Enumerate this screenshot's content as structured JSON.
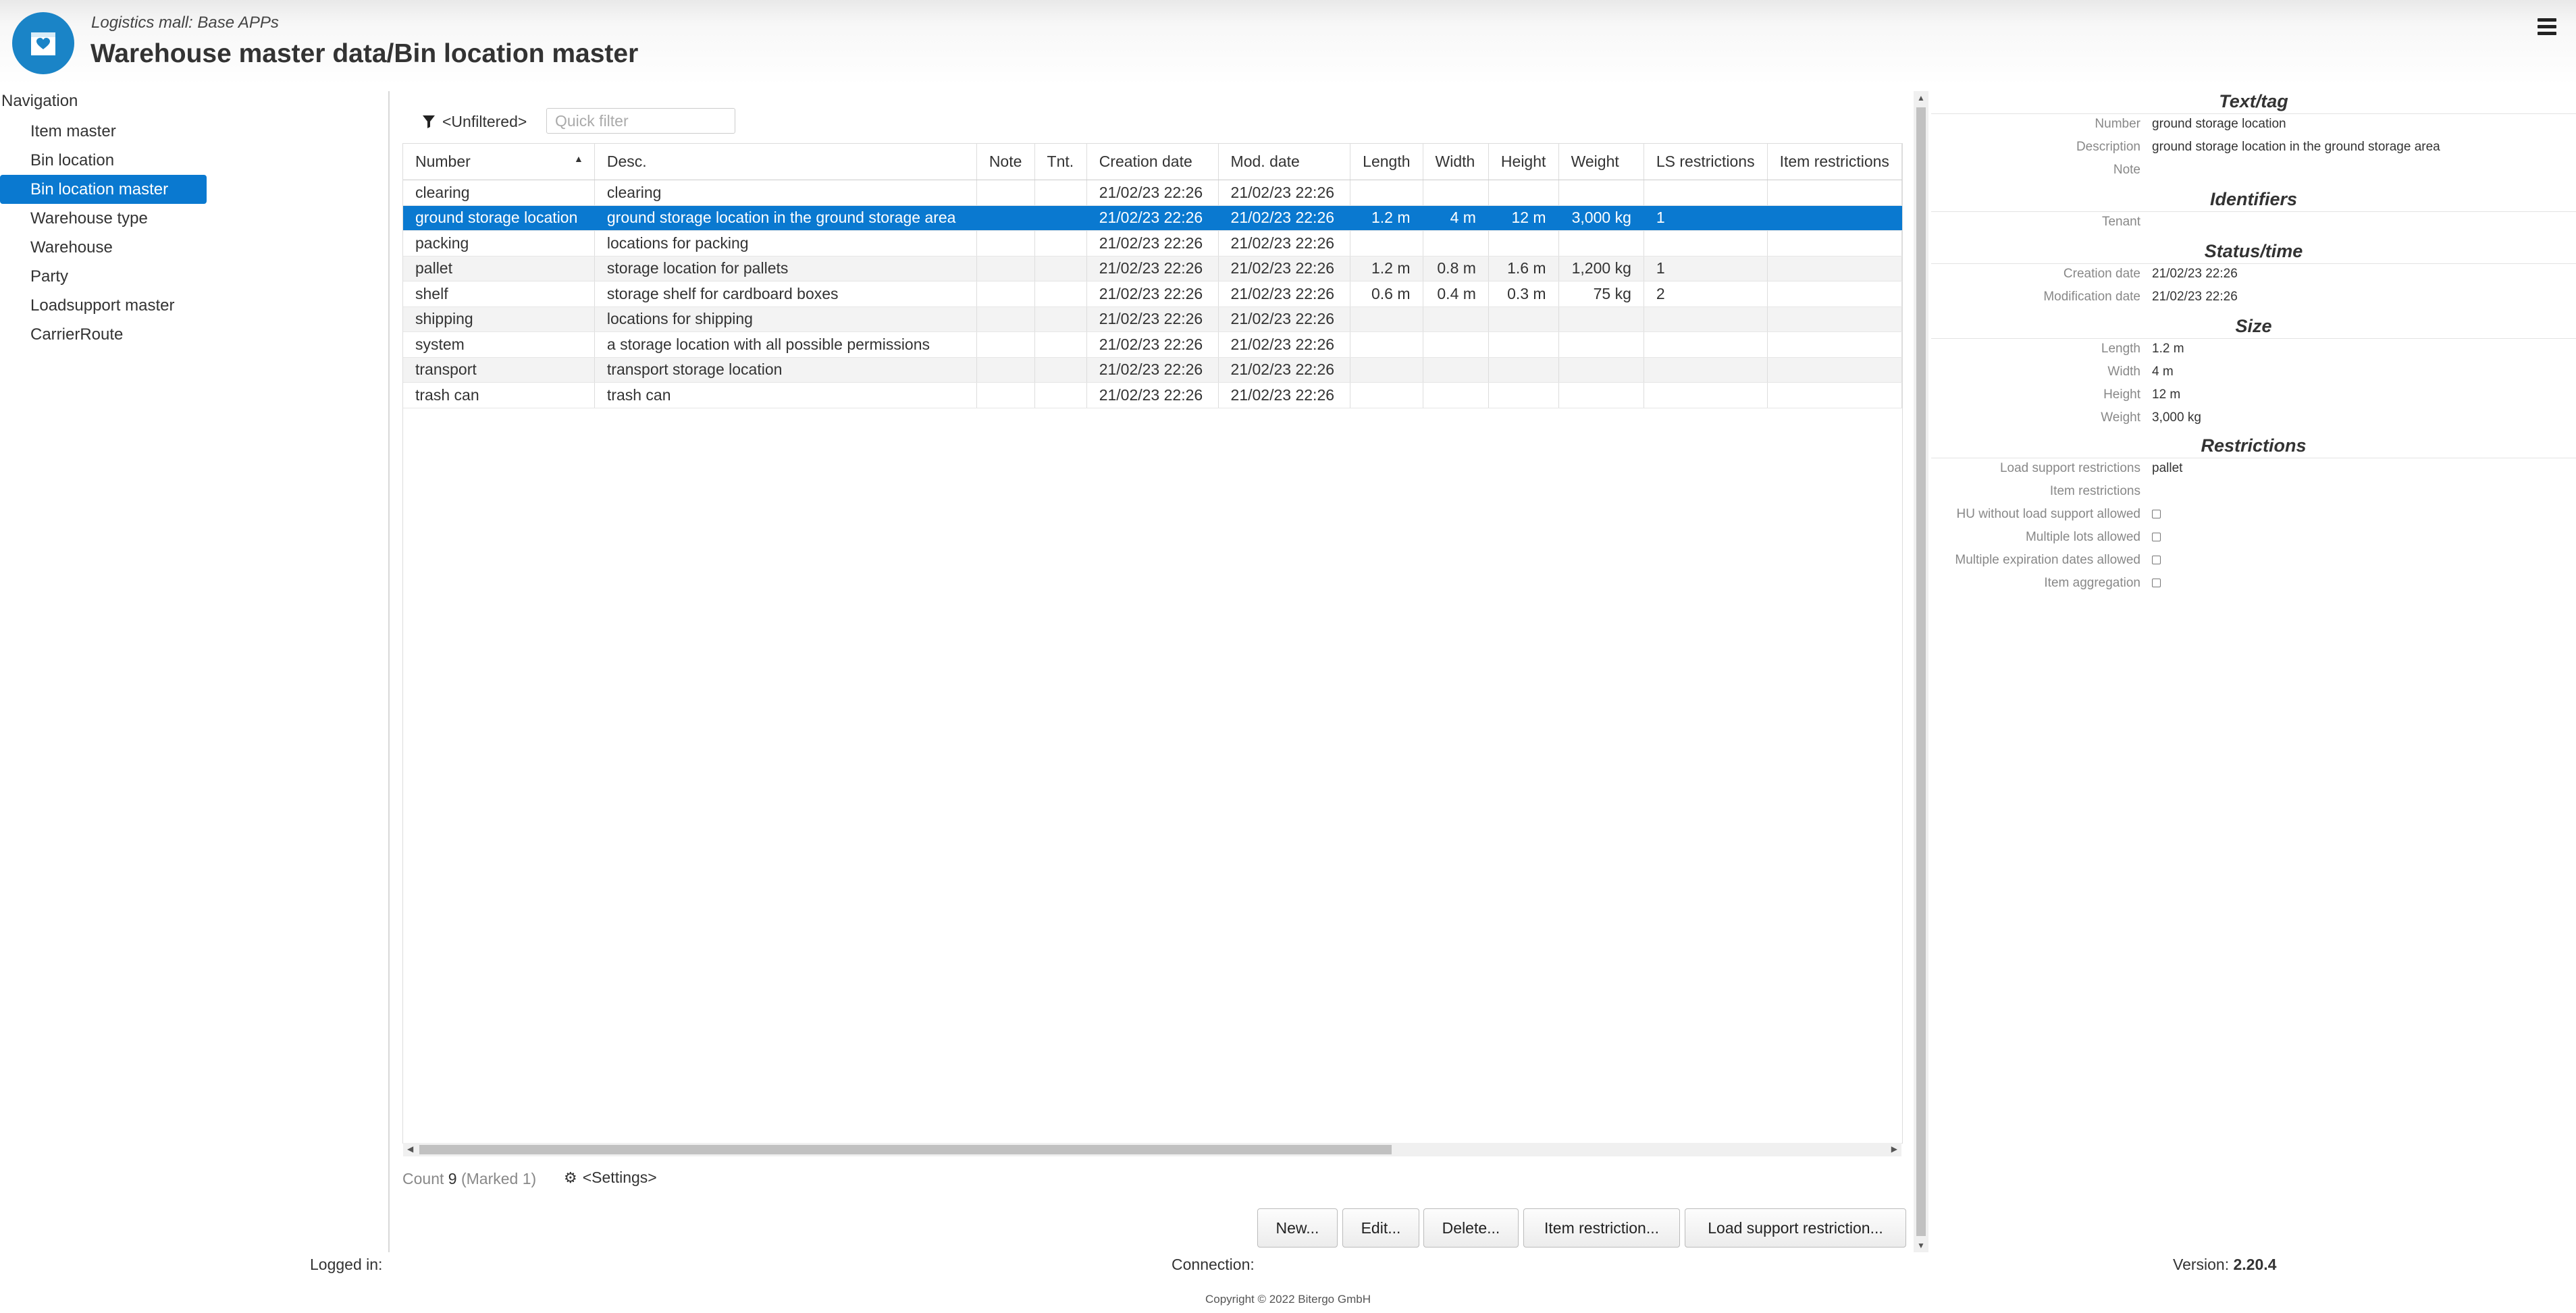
{
  "app": {
    "subtitle": "Logistics mall: Base APPs",
    "title": "Warehouse master data/Bin location master",
    "brand_color": "#1a84c7",
    "accent_color": "#0a79d0"
  },
  "header": {
    "menu_icon": "hamburger-icon",
    "logo_icon": "logo-box-icon"
  },
  "nav": {
    "title": "Navigation",
    "items": [
      {
        "label": "Item master",
        "active": false
      },
      {
        "label": "Bin location",
        "active": false
      },
      {
        "label": "Bin location master",
        "active": true
      },
      {
        "label": "Warehouse type",
        "active": false
      },
      {
        "label": "Warehouse",
        "active": false
      },
      {
        "label": "Party",
        "active": false
      },
      {
        "label": "Loadsupport master",
        "active": false
      },
      {
        "label": "CarrierRoute",
        "active": false
      }
    ]
  },
  "filter": {
    "label": "<Unfiltered>",
    "placeholder": "Quick filter",
    "icon": "filter-icon"
  },
  "table": {
    "columns": [
      "Number",
      "Desc.",
      "Note",
      "Tnt.",
      "Creation date",
      "Mod. date",
      "Length",
      "Width",
      "Height",
      "Weight",
      "LS restrictions",
      "Item restrictions"
    ],
    "sorted_column": "Number",
    "sort_direction": "ascending",
    "rows": [
      [
        "clearing",
        "clearing",
        "",
        "",
        "21/02/23 22:26",
        "21/02/23 22:26",
        "",
        "",
        "",
        "",
        "",
        ""
      ],
      [
        "ground storage location",
        "ground storage location in the ground storage area",
        "",
        "",
        "21/02/23 22:26",
        "21/02/23 22:26",
        "1.2 m",
        "4 m",
        "12 m",
        "3,000 kg",
        "1",
        ""
      ],
      [
        "packing",
        "locations for packing",
        "",
        "",
        "21/02/23 22:26",
        "21/02/23 22:26",
        "",
        "",
        "",
        "",
        "",
        ""
      ],
      [
        "pallet",
        "storage location for pallets",
        "",
        "",
        "21/02/23 22:26",
        "21/02/23 22:26",
        "1.2 m",
        "0.8 m",
        "1.6 m",
        "1,200 kg",
        "1",
        ""
      ],
      [
        "shelf",
        "storage shelf for cardboard boxes",
        "",
        "",
        "21/02/23 22:26",
        "21/02/23 22:26",
        "0.6 m",
        "0.4 m",
        "0.3 m",
        "75 kg",
        "2",
        ""
      ],
      [
        "shipping",
        "locations for shipping",
        "",
        "",
        "21/02/23 22:26",
        "21/02/23 22:26",
        "",
        "",
        "",
        "",
        "",
        ""
      ],
      [
        "system",
        "a storage location with all possible permissions",
        "",
        "",
        "21/02/23 22:26",
        "21/02/23 22:26",
        "",
        "",
        "",
        "",
        "",
        ""
      ],
      [
        "transport",
        "transport storage location",
        "",
        "",
        "21/02/23 22:26",
        "21/02/23 22:26",
        "",
        "",
        "",
        "",
        "",
        ""
      ],
      [
        "trash can",
        "trash can",
        "",
        "",
        "21/02/23 22:26",
        "21/02/23 22:26",
        "",
        "",
        "",
        "",
        "",
        ""
      ]
    ],
    "selected_row": 1
  },
  "status": {
    "count_label": "Count",
    "count": "9",
    "marked": "(Marked 1)",
    "settings": "<Settings>"
  },
  "buttons": {
    "new": "New...",
    "edit": "Edit...",
    "delete": "Delete...",
    "item_restriction": "Item restriction...",
    "load_support_restriction": "Load support restriction..."
  },
  "detail": {
    "text_tag": {
      "title": "Text/tag",
      "number_label": "Number",
      "number": "ground storage location",
      "description_label": "Description",
      "description": "ground storage location in the ground storage area",
      "note_label": "Note",
      "note": ""
    },
    "identifiers": {
      "title": "Identifiers",
      "tenant_label": "Tenant",
      "tenant": ""
    },
    "status_time": {
      "title": "Status/time",
      "creation_label": "Creation date",
      "creation": "21/02/23 22:26",
      "modification_label": "Modification date",
      "modification": "21/02/23 22:26"
    },
    "size": {
      "title": "Size",
      "length_label": "Length",
      "length": "1.2 m",
      "width_label": "Width",
      "width": "4 m",
      "height_label": "Height",
      "height": "12 m",
      "weight_label": "Weight",
      "weight": "3,000 kg"
    },
    "restrictions": {
      "title": "Restrictions",
      "load_support_label": "Load support restrictions",
      "load_support": "pallet",
      "item_label": "Item restrictions",
      "item": "",
      "hu_label": "HU without load support allowed",
      "hu": false,
      "multi_lots_label": "Multiple lots allowed",
      "multi_lots": false,
      "multi_exp_label": "Multiple expiration dates allowed",
      "multi_exp": false,
      "aggregation_label": "Item aggregation",
      "aggregation": false
    }
  },
  "footer": {
    "logged_in": "Logged in:",
    "connection": "Connection:",
    "version_label": "Version:",
    "version": "2.20.4",
    "copyright": "Copyright © 2022 Bitergo GmbH"
  }
}
